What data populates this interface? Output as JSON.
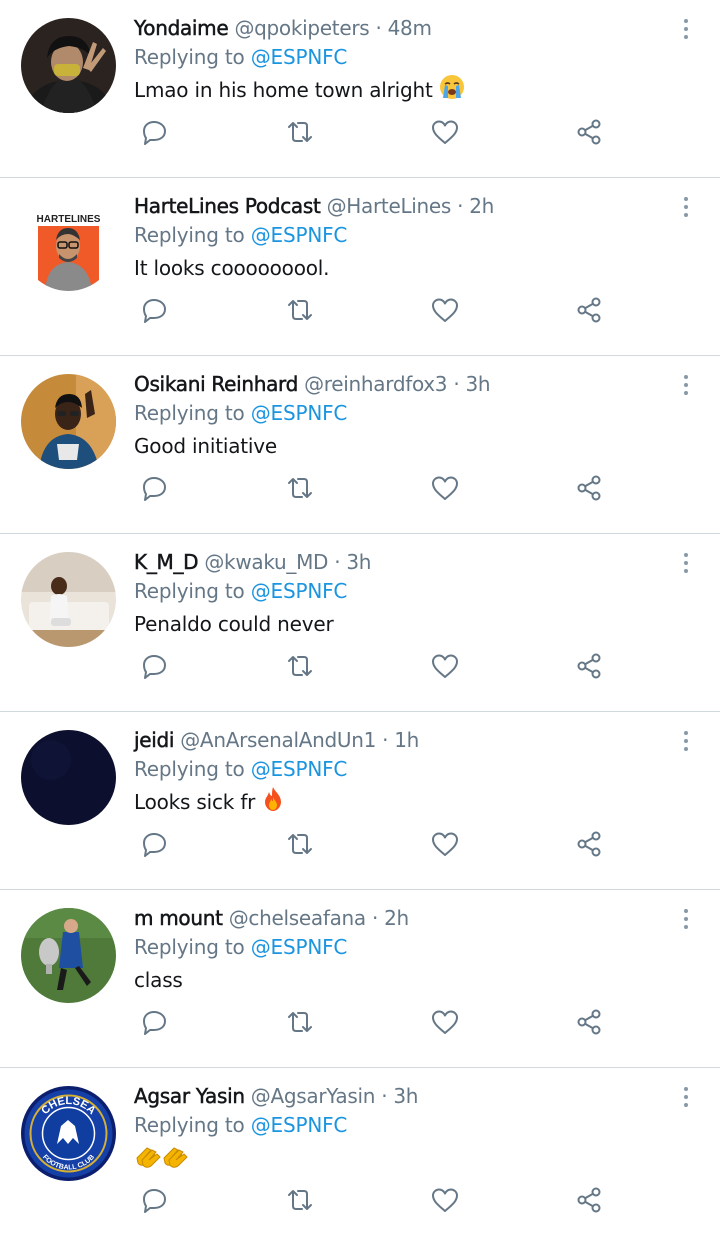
{
  "reply_prefix": "Replying to",
  "colors": {
    "link": "#1b95e0",
    "secondary": "#657786",
    "icon": "#657786",
    "divider": "#cfd9de"
  },
  "tweets": [
    {
      "name": "Yondaime",
      "handle": "@qpokipeters",
      "dot": "·",
      "time": "48m",
      "reply_to": "@ESPNFC",
      "text": "Lmao in his home town alright",
      "emoji": "loudly-crying-face",
      "avatar": "person-hoodie-peace-sign"
    },
    {
      "name": "HarteLines Podcast",
      "handle": "@HarteLines",
      "dot": "·",
      "time": "2h",
      "reply_to": "@ESPNFC",
      "text": "It looks cooooooool.",
      "emoji": "",
      "avatar": "hartelines-logo",
      "avatar_text": "HARTELINES"
    },
    {
      "name": "Osikani Reinhard",
      "handle": "@reinhardfox3",
      "dot": "·",
      "time": "3h",
      "reply_to": "@ESPNFC",
      "text": "Good initiative",
      "emoji": "",
      "avatar": "man-selfie"
    },
    {
      "name": "K_M_D",
      "handle": "@kwaku_MD",
      "dot": "·",
      "time": "3h",
      "reply_to": "@ESPNFC",
      "text": "Penaldo could never",
      "emoji": "",
      "avatar": "child-on-sofa"
    },
    {
      "name": "jeidi",
      "handle": "@AnArsenalAndUn1",
      "dot": "·",
      "time": "1h",
      "reply_to": "@ESPNFC",
      "text": "Looks sick fr",
      "emoji": "fire",
      "avatar": "dark-navy"
    },
    {
      "name": "m mount",
      "handle": "@chelseafana",
      "dot": "·",
      "time": "2h",
      "reply_to": "@ESPNFC",
      "text": "class",
      "emoji": "",
      "avatar": "footballer-with-trophy"
    },
    {
      "name": "Agsar Yasin",
      "handle": "@AgsarYasin",
      "dot": "·",
      "time": "3h",
      "reply_to": "@ESPNFC",
      "text": "",
      "emoji": "clapping-hands-x2",
      "avatar": "chelsea-crest",
      "avatar_text": "CHELSEA",
      "avatar_subtext": "FOOTBALL CLUB"
    }
  ],
  "icons": {
    "reply": "reply-icon",
    "retweet": "retweet-icon",
    "like": "heart-icon",
    "share": "share-icon",
    "more": "more-vertical-icon"
  }
}
